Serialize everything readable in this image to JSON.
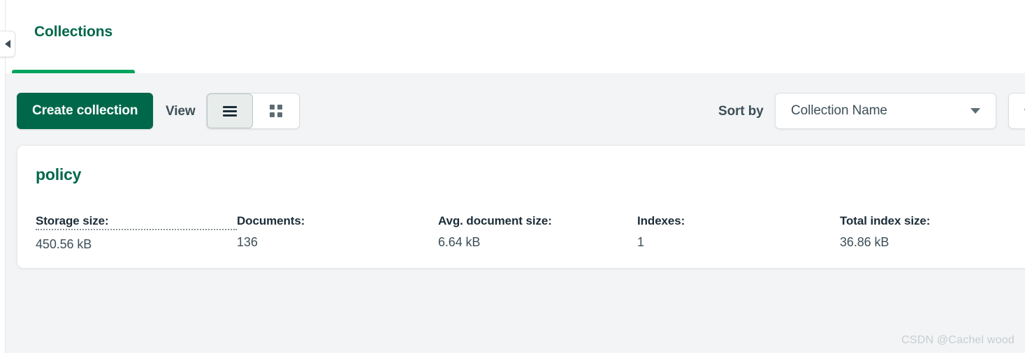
{
  "window": {
    "tab_title": "Collections"
  },
  "nav": {
    "collapse_icon": "chevron-left-icon"
  },
  "toolbar": {
    "create_collection_label": "Create collection",
    "view_label": "View",
    "view_modes": [
      {
        "id": "list",
        "icon": "list-view-icon",
        "active": true
      },
      {
        "id": "grid",
        "icon": "grid-view-icon",
        "active": false
      }
    ],
    "sort_by_label": "Sort by",
    "sort_by_value": "Collection Name",
    "sort_by_caret_icon": "chevron-down-icon",
    "sort_direction_icon": "arrow-up-icon",
    "sort_direction_glyph": "↑"
  },
  "collections": [
    {
      "name": "policy",
      "stats": [
        {
          "label": "Storage size:",
          "value": "450.56 kB",
          "has_tooltip": true
        },
        {
          "label": "Documents:",
          "value": "136",
          "has_tooltip": false
        },
        {
          "label": "Avg. document size:",
          "value": "6.64 kB",
          "has_tooltip": false
        },
        {
          "label": "Indexes:",
          "value": "1",
          "has_tooltip": false
        },
        {
          "label": "Total index size:",
          "value": "36.86 kB",
          "has_tooltip": false
        }
      ]
    }
  ],
  "watermark": {
    "text": "CSDN @Cachel wood"
  },
  "colors": {
    "brand_green_dark": "#00684A",
    "brand_green_bright": "#00A35C",
    "page_background": "#F2F4F5",
    "card_background": "#FFFFFF",
    "text_dark": "#1C2D38",
    "text_muted": "#3D4F58",
    "watermark": "#C9CDD0"
  }
}
